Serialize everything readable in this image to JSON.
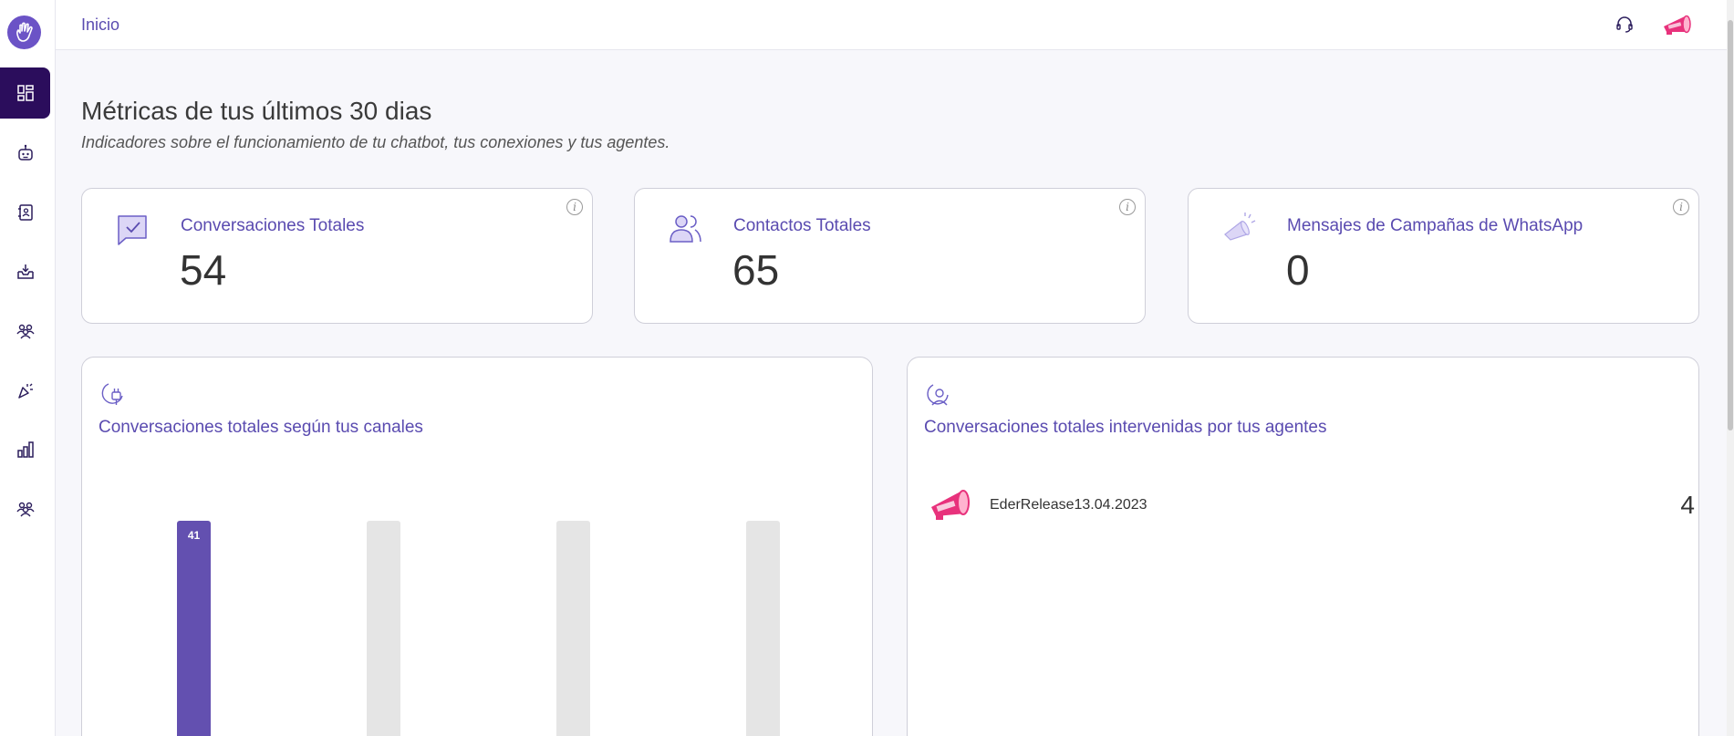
{
  "topbar": {
    "breadcrumb": "Inicio"
  },
  "header": {
    "title": "Métricas de tus últimos 30 dias",
    "subtitle": "Indicadores sobre el funcionamiento de tu chatbot, tus conexiones y tus agentes."
  },
  "metrics": [
    {
      "label": "Conversaciones Totales",
      "value": "54",
      "icon": "chat-check-icon"
    },
    {
      "label": "Contactos Totales",
      "value": "65",
      "icon": "contacts-icon"
    },
    {
      "label": "Mensajes de Campañas de WhatsApp",
      "value": "0",
      "icon": "megaphone-icon"
    }
  ],
  "panels": {
    "channels": {
      "title": "Conversaciones totales según tus canales"
    },
    "agents": {
      "title": "Conversaciones totales intervenidas por tus agentes",
      "items": [
        {
          "name": "EderRelease13.04.2023",
          "count": "4"
        }
      ]
    }
  },
  "chart_data": {
    "type": "bar",
    "categories": [
      "",
      "",
      "",
      ""
    ],
    "values": [
      41,
      0,
      0,
      0
    ],
    "data_labels": [
      "41",
      "",
      "",
      ""
    ],
    "colors": {
      "active": "#6350b0",
      "placeholder": "#e5e5e5"
    }
  },
  "colors": {
    "accent": "#5a4bb0",
    "sidebar_active": "#2b0d5c",
    "brand_pink": "#e8327c"
  }
}
